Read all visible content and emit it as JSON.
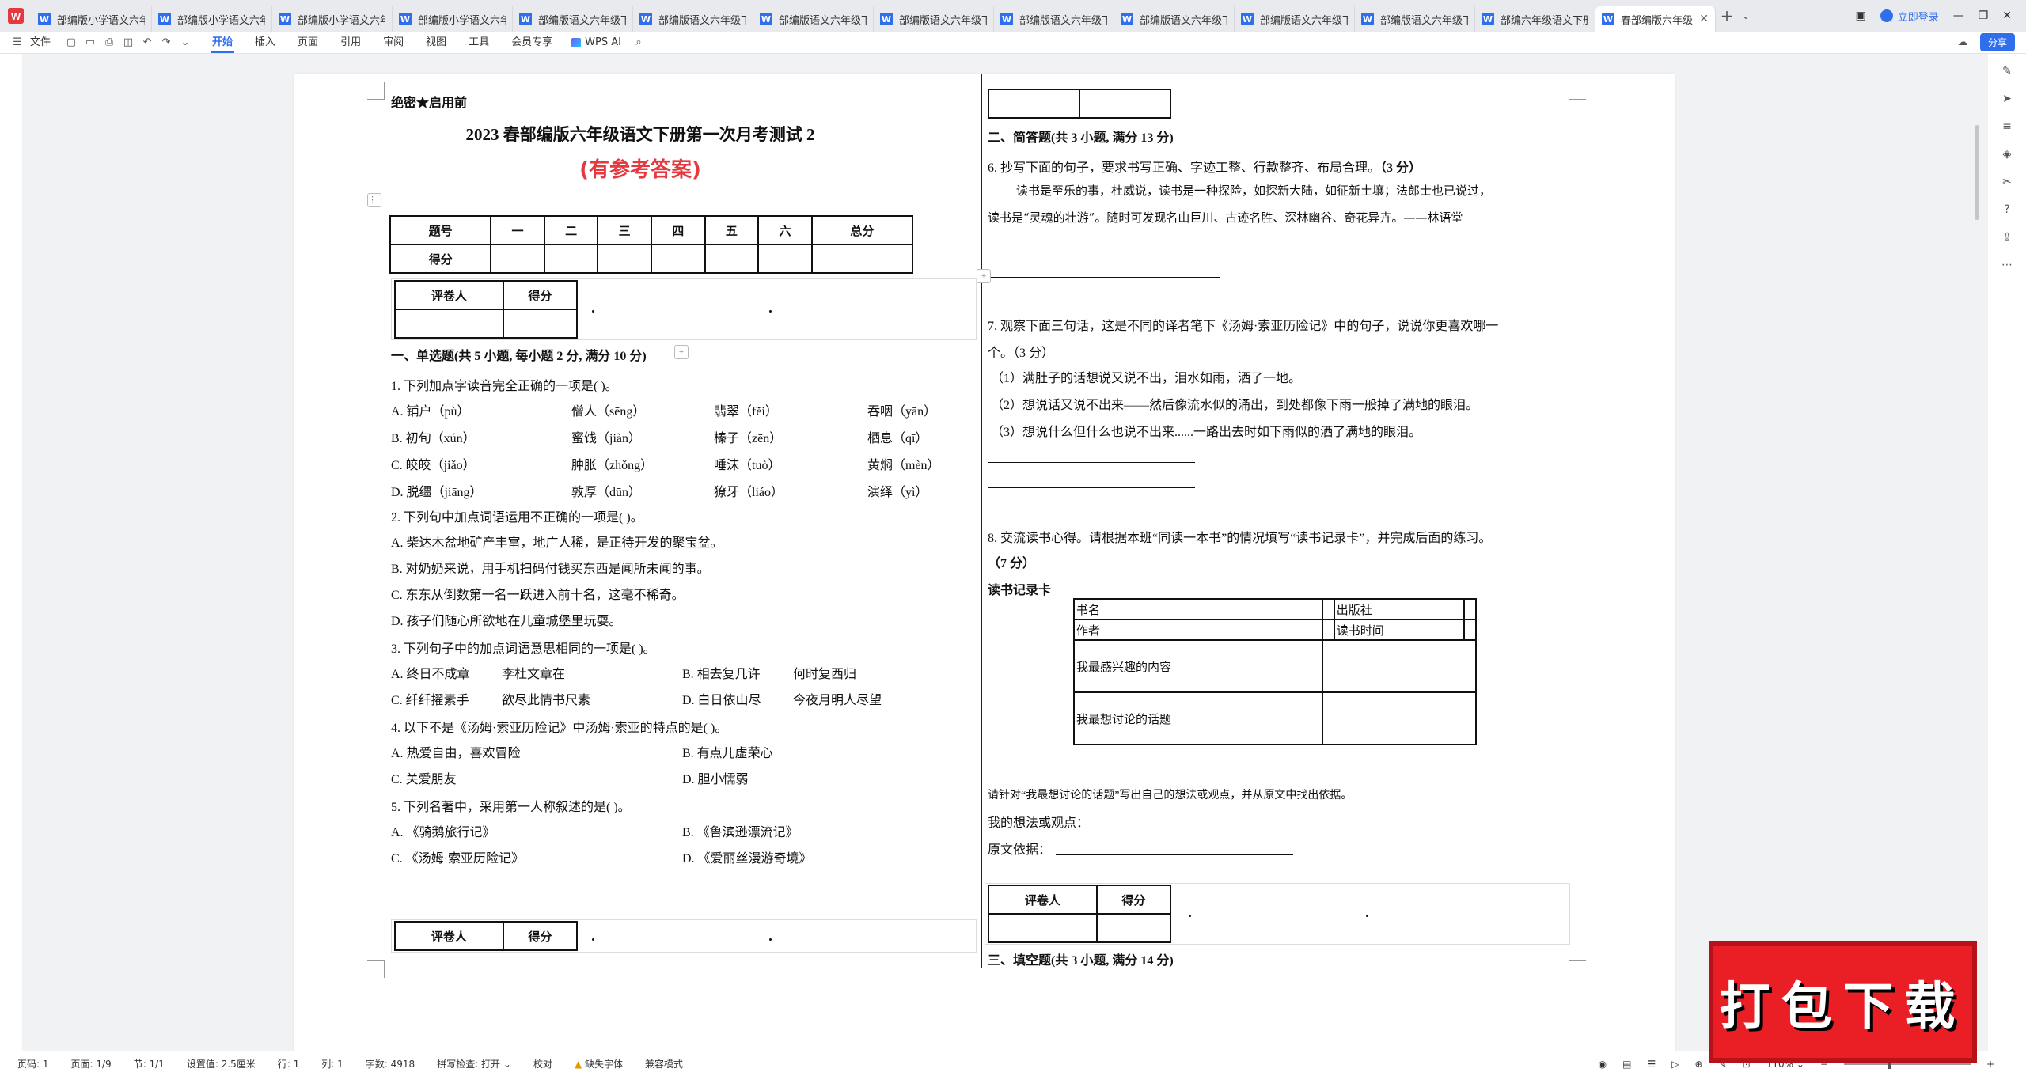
{
  "tabs": [
    "部编版小学语文六年级下册",
    "部编版小学语文六年级下册",
    "部编版小学语文六年级下册",
    "部编版小学语文六年级下册",
    "部编版语文六年级下册",
    "部编版语文六年级下册",
    "部编版语文六年级下册",
    "部编版语文六年级下册",
    "部编版语文六年级下册",
    "部编版语文六年级下册",
    "部编版语文六年级下册",
    "部编版语文六年级下册",
    "部编六年级语文下册",
    "春部编版六年级"
  ],
  "tab_letter": "W",
  "window": {
    "login": "立即登录"
  },
  "menu": {
    "file": "文件",
    "items": [
      "开始",
      "插入",
      "页面",
      "引用",
      "审阅",
      "视图",
      "工具",
      "会员专享"
    ],
    "wps_ai": "WPS AI",
    "share": "分享"
  },
  "doc": {
    "secret": "绝密★启用前",
    "title": "2023 春部编版六年级语文下册第一次月考测试 2",
    "subtitle": "(有参考答案)",
    "score_headers": [
      "题号",
      "一",
      "二",
      "三",
      "四",
      "五",
      "六",
      "总分"
    ],
    "score_row_label": "得分",
    "grader_headers": [
      "评卷人",
      "得分"
    ],
    "sec1": "一、单选题(共 5 小题, 每小题 2 分, 满分 10 分)",
    "q1": "1. 下列加点字读音完全正确的一项是(          )。",
    "q1_opts": [
      [
        "A. 铺户（pù）",
        "僧人（sēng）",
        "翡翠（fěi）",
        "吞咽（yān）"
      ],
      [
        "B. 初旬（xún）",
        "蜜饯（jiàn）",
        "榛子（zēn）",
        "栖息（qī）"
      ],
      [
        "C. 皎皎（jiǎo）",
        "肿胀（zhǒng）",
        "唾沫（tuò）",
        "黄焖（mèn）"
      ],
      [
        "D. 脱缰（jiāng）",
        "敦厚（dūn）",
        "獠牙（liáo）",
        "演绎（yì）"
      ]
    ],
    "q2": "2. 下列句中加点词语运用不正确的一项是(          )。",
    "q2_opts": [
      "A. 柴达木盆地矿产丰富，地广人稀，是正待开发的聚宝盆。",
      "B. 对奶奶来说，用手机扫码付钱买东西是闻所未闻的事。",
      "C. 东东从倒数第一名一跃进入前十名，这毫不稀奇。",
      "D. 孩子们随心所欲地在儿童城堡里玩耍。"
    ],
    "q3": "3. 下列句子中的加点词语意思相同的一项是(              )。",
    "q3_opts": [
      [
        "A. 终日不成章",
        "李杜文章在",
        "B. 相去复几许",
        "何时复西归"
      ],
      [
        "C. 纤纤擢素手",
        "欲尽此情书尺素",
        "D. 白日依山尽",
        "今夜月明人尽望"
      ]
    ],
    "q4": "4. 以下不是《汤姆·索亚历险记》中汤姆·索亚的特点的是(          )。",
    "q4_opts": [
      "A. 热爱自由，喜欢冒险",
      "B. 有点儿虚荣心",
      "C. 关爱朋友",
      "D. 胆小懦弱"
    ],
    "q5": "5. 下列名著中，采用第一人称叙述的是(          )。",
    "q5_opts": [
      "A. 《骑鹅旅行记》",
      "B. 《鲁滨逊漂流记》",
      "C. 《汤姆·索亚历险记》",
      "D. 《爱丽丝漫游奇境》"
    ],
    "sec2": "二、简答题(共 3 小题, 满分 13 分)",
    "q6": "6. 抄写下面的句子，要求书写正确、字迹工整、行款整齐、布局合理。",
    "q6_points": "（3 分）",
    "q6_text1": "读书是至乐的事，杜威说，读书是一种探险，如探新大陆，如征新土壤；法郎士也已说过，",
    "q6_text2": "读书是“灵魂的壮游”。随时可发现名山巨川、古迹名胜、深林幽谷、奇花异卉。——林语堂",
    "q7": "7. 观察下面三句话，这是不同的译者笔下《汤姆·索亚历险记》中的句子，说说你更喜欢哪一",
    "q7_cont": "个。（3 分）",
    "q7_items": [
      "（1）满肚子的话想说又说不出，泪水如雨，洒了一地。",
      "（2）想说话又说不出来——然后像流水似的涌出，到处都像下雨一般掉了满地的眼泪。",
      "（3）想说什么但什么也说不出来......一路出去时如下雨似的洒了满地的眼泪。"
    ],
    "q8": "8. 交流读书心得。请根据本班“同读一本书”的情况填写“读书记录卡”，并完成后面的练习。",
    "q8_points": "（7 分）",
    "card_title": "读书记录卡",
    "card": {
      "book": "书名",
      "publisher": "出版社",
      "author": "作者",
      "read_time": "读书时间",
      "interest": "我最感兴趣的内容",
      "discuss": "我最想讨论的话题"
    },
    "q8_task": "请针对“我最想讨论的话题”写出自己的想法或观点，并从原文中找出依据。",
    "q8_view": "我的想法或观点：",
    "q8_basis": "原文依据：",
    "sec3": "三、填空题(共 3 小题, 满分 14 分)"
  },
  "status": {
    "page": "页码: 1",
    "pages": "页面: 1/9",
    "section": "节: 1/1",
    "margin": "设置值: 2.5厘米",
    "row": "行: 1",
    "col": "列: 1",
    "words": "字数: 4918",
    "spell": "拼写检查: 打开",
    "proof": "校对",
    "missing_font": "缺失字体",
    "compat": "兼容模式",
    "zoom": "110%"
  },
  "promo": "打包下载",
  "colors": {
    "accent": "#2f6fec",
    "red": "#e5393f",
    "promo": "#ea1f26"
  }
}
